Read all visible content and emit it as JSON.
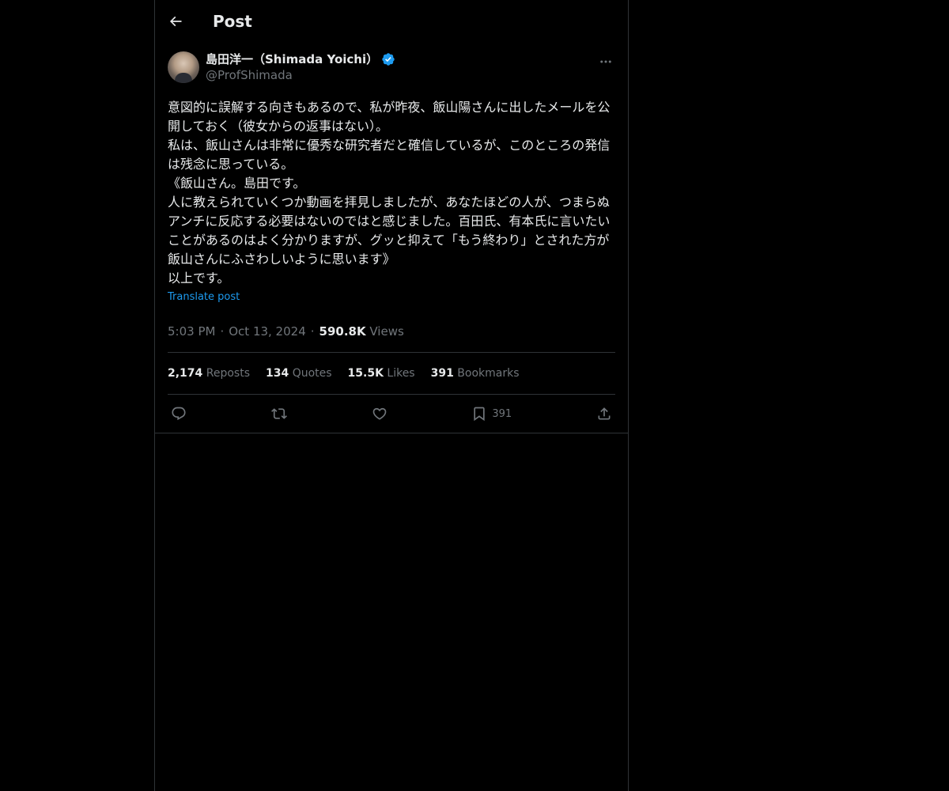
{
  "header": {
    "title": "Post"
  },
  "author": {
    "name": "島田洋一（Shimada Yoichi）",
    "handle": "@ProfShimada",
    "verified": true
  },
  "post": {
    "text": "意図的に誤解する向きもあるので、私が昨夜、飯山陽さんに出したメールを公開しておく（彼女からの返事はない）。\n私は、飯山さんは非常に優秀な研究者だと確信しているが、このところの発信は残念に思っている。\n《飯山さん。島田です。\n人に教えられていくつか動画を拝見しましたが、あなたほどの人が、つまらぬアンチに反応する必要はないのではと感じました。百田氏、有本氏に言いたいことがあるのはよく分かりますが、グッと抑えて「もう終わり」とされた方が飯山さんにふさわしいように思います》\n以上です。",
    "translate_label": "Translate post",
    "time": "5:03 PM",
    "date": "Oct 13, 2024",
    "views_count": "590.8K",
    "views_label": "Views"
  },
  "stats": [
    {
      "num": "2,174",
      "label": "Reposts"
    },
    {
      "num": "134",
      "label": "Quotes"
    },
    {
      "num": "15.5K",
      "label": "Likes"
    },
    {
      "num": "391",
      "label": "Bookmarks"
    }
  ],
  "actions": {
    "bookmark_count": "391"
  },
  "colors": {
    "background": "#000000",
    "text": "#e7e9ea",
    "muted": "#71767b",
    "accent": "#1d9bf0",
    "border": "#2f3336"
  }
}
